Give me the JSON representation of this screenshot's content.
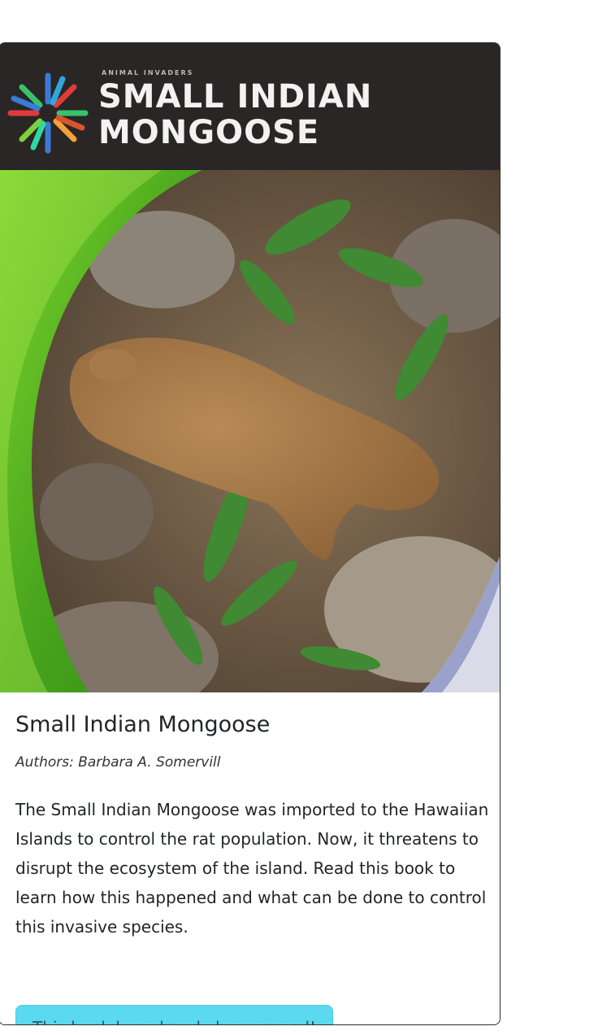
{
  "book": {
    "cover": {
      "series_label": "ANIMAL INVADERS",
      "title_line1": "SMALL INDIAN",
      "title_line2": "MONGOOSE",
      "image_alt": "Cover photo of a small Indian mongoose among leaves and rocks"
    },
    "title": "Small Indian Mongoose",
    "authors": "Authors: Barbara A. Somervill",
    "description": "The Small Indian Mongoose was imported to the Hawaiian Islands to control the rat population. Now, it threatens to disrupt the ecosystem of the island. Read this book to learn how this happened and what can be done to control this invasive species.",
    "status_message": "This book has already been saved!"
  },
  "colors": {
    "alert_bg": "#5ad9f0",
    "alert_text": "#3a5560",
    "cover_band": "#2a2626",
    "cover_green": "#5cbf2a"
  }
}
